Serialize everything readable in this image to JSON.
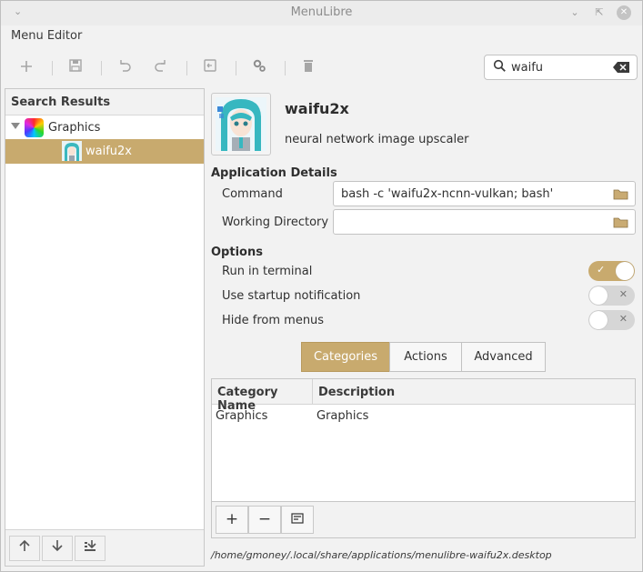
{
  "window": {
    "title": "MenuLibre",
    "menu": "Menu Editor"
  },
  "search": {
    "value": "waifu"
  },
  "left_pane": {
    "header": "Search Results",
    "category": "Graphics",
    "selected_item": "waifu2x"
  },
  "app": {
    "name": "waifu2x",
    "comment": "neural network image upscaler"
  },
  "details": {
    "section_title": "Application Details",
    "command_label": "Command",
    "command_value": "bash -c  'waifu2x-ncnn-vulkan; bash'",
    "workdir_label": "Working Directory",
    "workdir_value": ""
  },
  "options": {
    "section_title": "Options",
    "items": [
      {
        "label": "Run in terminal",
        "enabled": true
      },
      {
        "label": "Use startup notification",
        "enabled": false
      },
      {
        "label": "Hide from menus",
        "enabled": false
      }
    ]
  },
  "tabs": {
    "active": "Categories",
    "labels": [
      "Categories",
      "Actions",
      "Advanced"
    ]
  },
  "categories_table": {
    "columns": [
      "Category Name",
      "Description"
    ],
    "rows": [
      [
        "Graphics",
        "Graphics"
      ]
    ]
  },
  "desktop_file_path": "/home/gmoney/.local/share/applications/menulibre-waifu2x.desktop",
  "colors": {
    "accent": "#c8aa6e"
  }
}
